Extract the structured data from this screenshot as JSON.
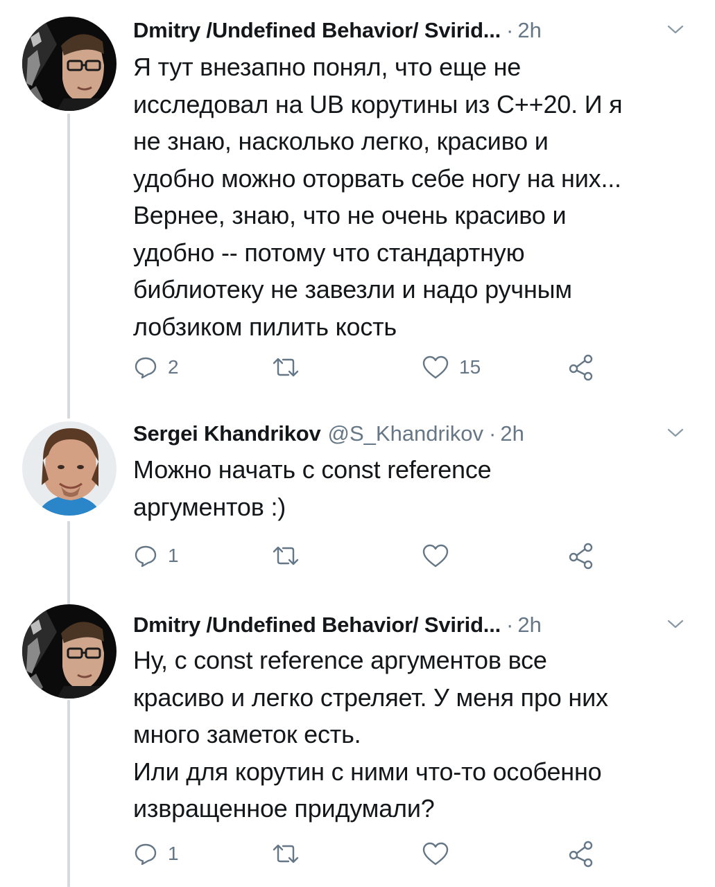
{
  "tweets": [
    {
      "author": "Dmitry /Undefined Behavior/ Svirid...",
      "handle": "",
      "dot": "·",
      "time": "2h",
      "text": "Я тут внезапно понял, что еще не\nисследовал на UB корутины из C++20. И я\nне знаю, насколько легко, красиво и\nудобно можно оторвать себе ногу на них...\nВернее, знаю, что не очень красиво и\nудобно -- потому что стандартную\nбиблиотеку не завезли и надо ручным\nлобзиком пилить кость",
      "reply_count": "2",
      "retweet_count": "",
      "like_count": "15"
    },
    {
      "author": "Sergei Khandrikov",
      "handle": "@S_Khandrikov",
      "dot": "·",
      "time": "2h",
      "text": "Можно начать с const reference\nаргументов :)",
      "reply_count": "1",
      "retweet_count": "",
      "like_count": ""
    },
    {
      "author": "Dmitry /Undefined Behavior/ Svirid...",
      "handle": "",
      "dot": "·",
      "time": "2h",
      "text": "Ну, с const reference аргументов все\nкрасиво и легко стреляет. У меня про них\nмного заметок есть.\nИли для корутин с ними что-то особенно\nизвращенное придумали?",
      "reply_count": "1",
      "retweet_count": "",
      "like_count": ""
    }
  ],
  "icons": {
    "reply": "reply-icon",
    "retweet": "retweet-icon",
    "like": "heart-icon",
    "share": "share-icon",
    "menu": "chevron-down-icon"
  },
  "colors": {
    "text": "#14171a",
    "muted": "#657786",
    "thread_line": "#d6dadd"
  }
}
